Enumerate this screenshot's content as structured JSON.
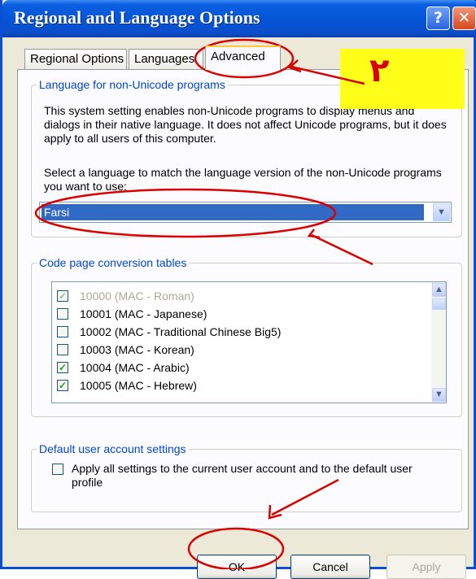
{
  "window": {
    "title": "Regional and Language Options"
  },
  "titlebar_buttons": {
    "help": "?",
    "close": "✕"
  },
  "tabs": [
    {
      "label": "Regional Options",
      "active": false
    },
    {
      "label": "Languages",
      "active": false
    },
    {
      "label": "Advanced",
      "active": true
    }
  ],
  "non_unicode": {
    "legend": "Language for non-Unicode programs",
    "description": "This system setting enables non-Unicode programs to display menus and dialogs in their native language. It does not affect Unicode programs, but it does apply to all users of this computer.",
    "select_prompt": "Select a language to match the language version of the non-Unicode programs you want to use:",
    "selected_language": "Farsi"
  },
  "code_pages": {
    "legend": "Code page conversion tables",
    "items": [
      {
        "label": "10000 (MAC - Roman)",
        "checked": true,
        "disabled": true
      },
      {
        "label": "10001 (MAC - Japanese)",
        "checked": false,
        "disabled": false
      },
      {
        "label": "10002 (MAC - Traditional Chinese Big5)",
        "checked": false,
        "disabled": false
      },
      {
        "label": "10003 (MAC - Korean)",
        "checked": false,
        "disabled": false
      },
      {
        "label": "10004 (MAC - Arabic)",
        "checked": true,
        "disabled": false
      },
      {
        "label": "10005 (MAC - Hebrew)",
        "checked": true,
        "disabled": false
      }
    ]
  },
  "default_user": {
    "legend": "Default user account settings",
    "checkbox_label": "Apply all settings to the current user account and to the default user profile",
    "checked": false
  },
  "buttons": {
    "ok": "OK",
    "cancel": "Cancel",
    "apply": "Apply"
  },
  "annotation": {
    "step_number": "۲",
    "box_color": "#ffff1a",
    "marker_color": "#d80000"
  },
  "colors": {
    "titlebar": "#0554d6",
    "selection": "#316ac5",
    "legend_text": "#0046d5"
  }
}
